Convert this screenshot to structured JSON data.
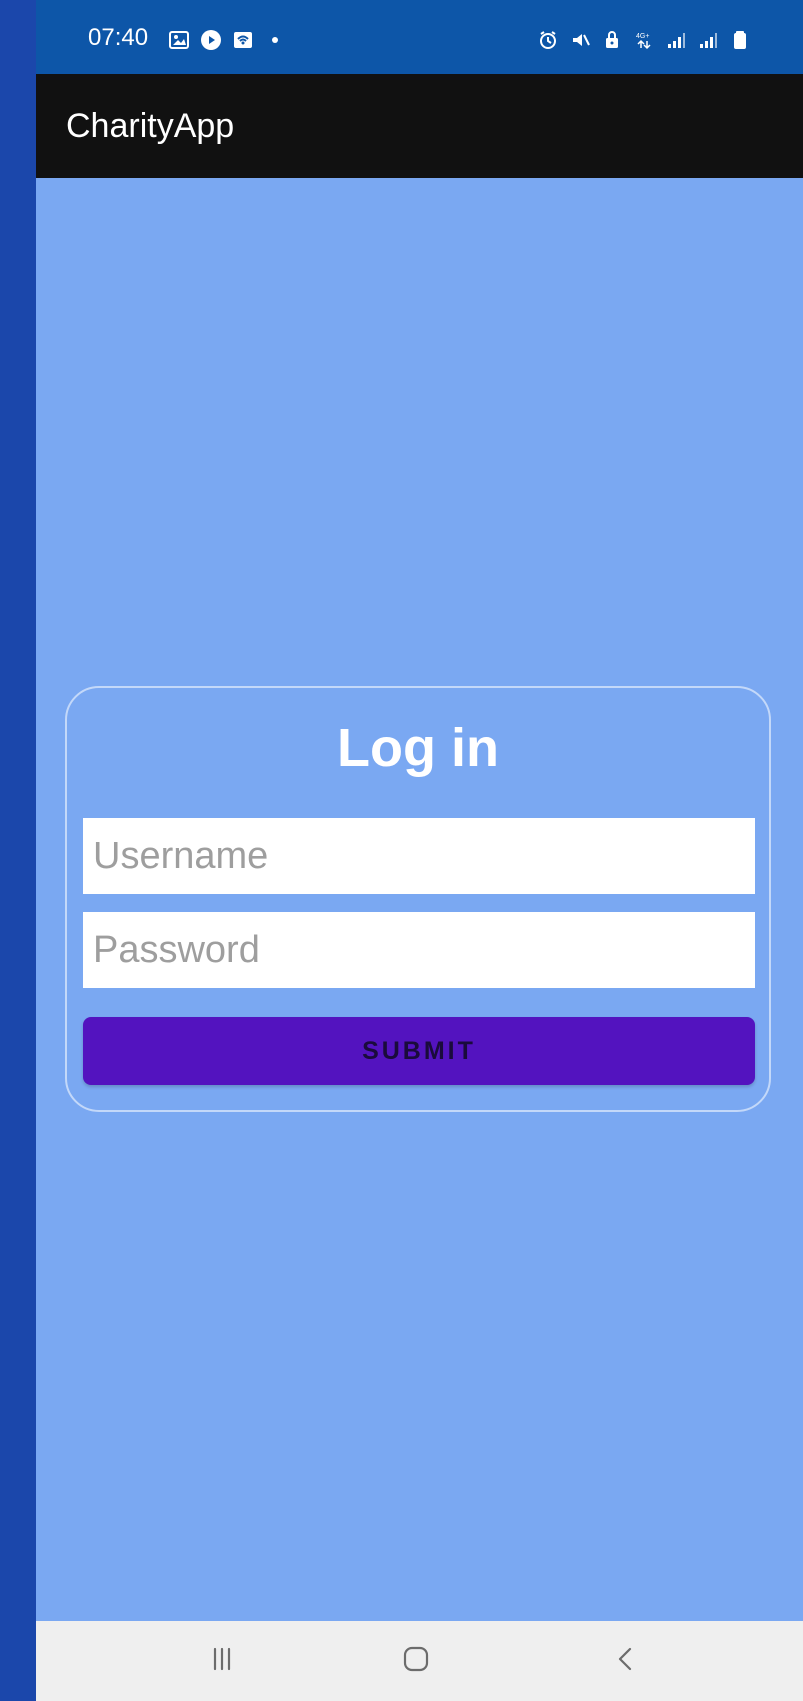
{
  "status_bar": {
    "time": "07:40",
    "left_icons": [
      "image-icon",
      "play-icon",
      "wifi-calling-icon",
      "dot-icon"
    ],
    "right_icons": [
      "alarm-icon",
      "mute-icon",
      "lock-icon",
      "network-4g-icon",
      "signal-icon",
      "signal-icon-2",
      "battery-icon"
    ],
    "background": "#0d56a8"
  },
  "app_bar": {
    "title": "CharityApp",
    "background": "#111111"
  },
  "login": {
    "title": "Log in",
    "username_placeholder": "Username",
    "password_placeholder": "Password",
    "submit_label": "SUBMIT",
    "submit_color": "#5313bf"
  },
  "colors": {
    "page_background": "#7aa8f2",
    "outer_background": "#1b47ab",
    "card_border": "#d9e6ff"
  },
  "nav_bar": {
    "buttons": [
      "recents-icon",
      "home-icon",
      "back-icon"
    ]
  }
}
